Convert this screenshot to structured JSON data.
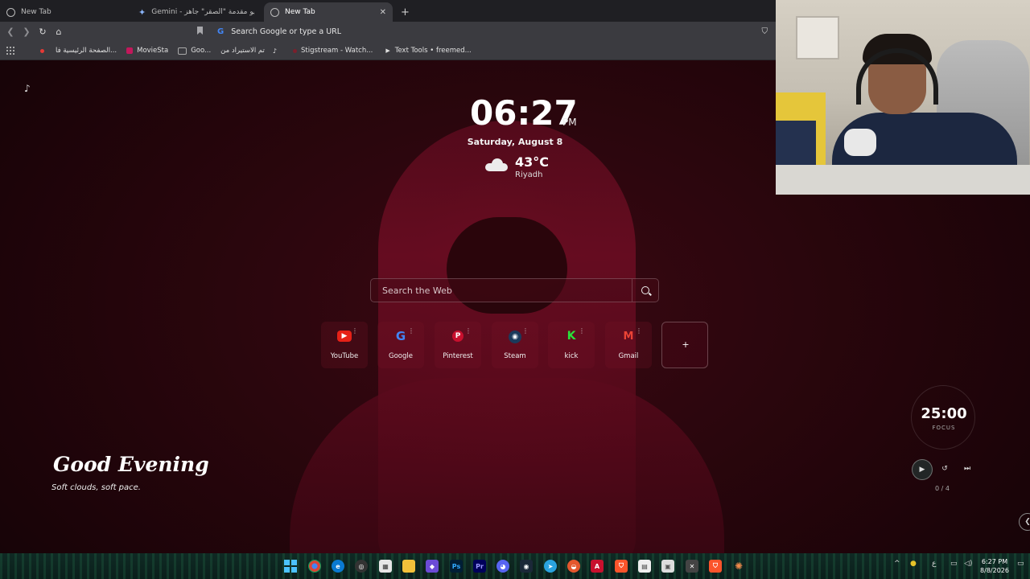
{
  "browser": {
    "tabs": [
      {
        "label": "New Tab",
        "active": false
      },
      {
        "label": "Gemini - سيناريو مقدمة \"الصقر\" جاهز",
        "active": false
      },
      {
        "label": "New Tab",
        "active": true
      }
    ],
    "omnibox_text": "Search Google or type a URL",
    "bookmarks": [
      {
        "label": "الصفحة الرئيسية فا...",
        "color": "#e53935"
      },
      {
        "label": "MovieSta",
        "color": "#c2185b"
      },
      {
        "label": "Goo...",
        "color": "#9e9e9e"
      },
      {
        "label": "تم الاستيراد من",
        "color": "#9e9e9e"
      },
      {
        "label": "Stigstream - Watch...",
        "color": "#7b1f2c"
      },
      {
        "label": "Text Tools • freemed...",
        "color": "#ffffff"
      }
    ]
  },
  "newtab": {
    "time": "06:27",
    "ampm": "PM",
    "date": "Saturday, August 8",
    "temperature": "43°C",
    "city": "Riyadh",
    "search_placeholder": "Search the Web",
    "shortcuts": [
      {
        "label": "YouTube",
        "icon": "youtube-icon",
        "color": "#e62117",
        "glyph": "▶"
      },
      {
        "label": "Google",
        "icon": "google-icon",
        "color": "#4285f4",
        "glyph": "G"
      },
      {
        "label": "Pinterest",
        "icon": "pinterest-icon",
        "color": "#c8102e",
        "glyph": "P"
      },
      {
        "label": "Steam",
        "icon": "steam-icon",
        "color": "#2a5d8f",
        "glyph": "◉"
      },
      {
        "label": "kick",
        "icon": "kick-icon",
        "color": "#29c33b",
        "glyph": "K"
      },
      {
        "label": "Gmail",
        "icon": "gmail-icon",
        "color": "#d93025",
        "glyph": "M"
      }
    ],
    "add_shortcut": "+",
    "greeting": "Good Evening",
    "greeting_sub": "Soft clouds, soft pace.",
    "pomodoro": {
      "time": "25:00",
      "mode": "FOCUS",
      "count": "0 / 4"
    }
  },
  "taskbar": {
    "clock_time": "6:27 PM",
    "clock_date": "8/8/2026",
    "language": "ع"
  }
}
